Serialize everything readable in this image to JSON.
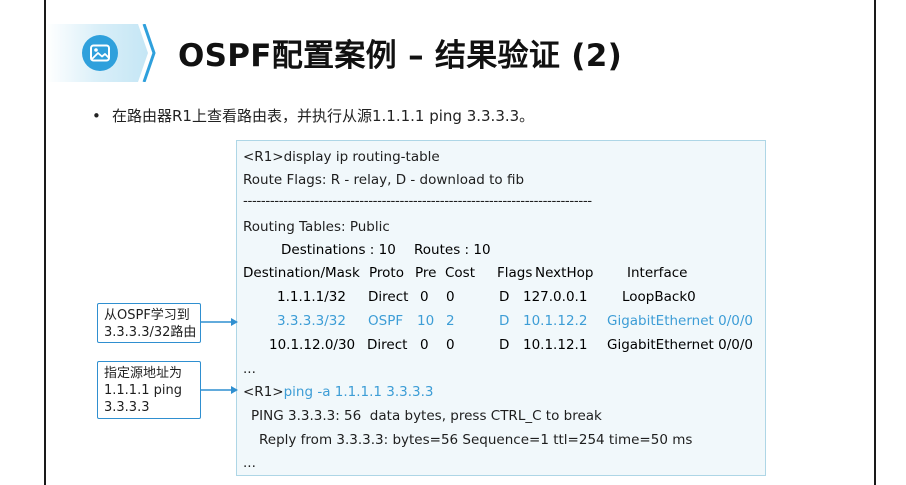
{
  "slide": {
    "title": "OSPF配置案例 – 结果验证 (2)",
    "title_icon": "image-icon",
    "accent_color": "#2fa0dc",
    "bullet": "在路由器R1上查看路由表，并执行从源1.1.1.1 ping 3.3.3.3。"
  },
  "terminal": {
    "prompt": "<R1>",
    "command1": "display ip routing-table",
    "flags_line": "Route Flags: R - relay, D - download to fib",
    "separator": "------------------------------------------------------------------------------",
    "tables_line": "Routing Tables: Public",
    "destinations_label": "Destinations : 10",
    "routes_label": "Routes : 10",
    "columns": [
      "Destination/Mask",
      "Proto",
      "Pre",
      "Cost",
      "Flags",
      "NextHop",
      "Interface"
    ],
    "rows": [
      {
        "dest": "1.1.1.1/32",
        "proto": "Direct",
        "pre": "0",
        "cost": "0",
        "flags": "D",
        "nexthop": "127.0.0.1",
        "iface": "LoopBack0"
      },
      {
        "dest": "3.3.3.3/32",
        "proto": "OSPF",
        "pre": "10",
        "cost": "2",
        "flags": "D",
        "nexthop": "10.1.12.2",
        "iface": "GigabitEthernet 0/0/0"
      },
      {
        "dest": "10.1.12.0/30",
        "proto": "Direct",
        "pre": "0",
        "cost": "0",
        "flags": "D",
        "nexthop": "10.1.12.1",
        "iface": "GigabitEthernet 0/0/0"
      }
    ],
    "ellipsis1": "...",
    "command2": "ping -a 1.1.1.1 3.3.3.3",
    "ping_line": "PING 3.3.3.3: 56  data bytes, press CTRL_C to break",
    "reply_line": "Reply from 3.3.3.3: bytes=56 Sequence=1 ttl=254 time=50 ms",
    "ellipsis2": "...",
    "highlight_color": "#3d9dd6"
  },
  "notes": {
    "note1": [
      "从OSPF学习到",
      "3.3.3.3/32路由"
    ],
    "note2": [
      "指定源地址为",
      "1.1.1.1 ping",
      "3.3.3.3"
    ]
  }
}
